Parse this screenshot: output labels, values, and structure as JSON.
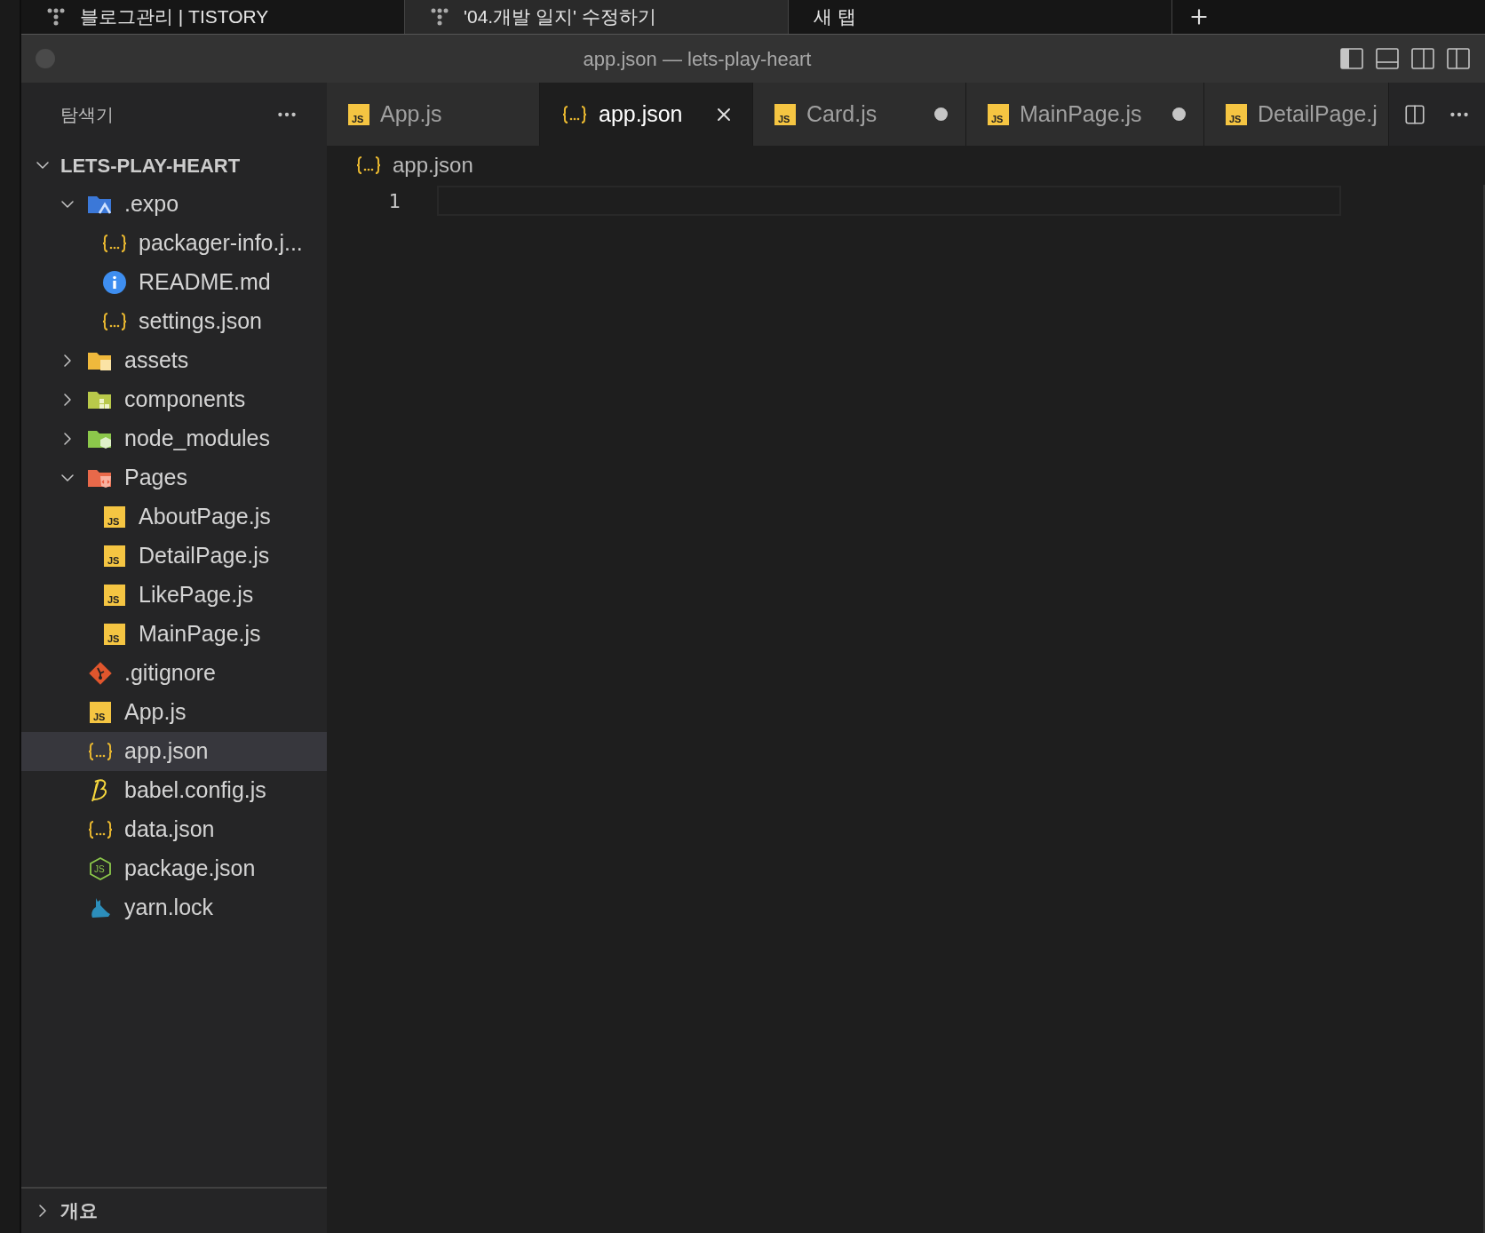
{
  "browser_tabs": [
    {
      "label": "블로그관리 | TISTORY",
      "selected": false
    },
    {
      "label": "'04.개발 일지' 수정하기",
      "selected": true
    },
    {
      "label": "새 탭",
      "selected": false
    }
  ],
  "window": {
    "title": "app.json — lets-play-heart"
  },
  "sidebar": {
    "title": "탐색기",
    "tree": {
      "label": "LETS-PLAY-HEART",
      "expanded": true,
      "children": [
        {
          "label": ".expo",
          "kind": "expo-folder",
          "expanded": true,
          "selected": false,
          "children": [
            {
              "label": "packager-info.j...",
              "kind": "json",
              "selected": false
            },
            {
              "label": "README.md",
              "kind": "info",
              "selected": false
            },
            {
              "label": "settings.json",
              "kind": "json",
              "selected": false
            }
          ]
        },
        {
          "label": "assets",
          "kind": "assets-folder",
          "expanded": false,
          "selected": false
        },
        {
          "label": "components",
          "kind": "components-folder",
          "expanded": false,
          "selected": false
        },
        {
          "label": "node_modules",
          "kind": "node-folder",
          "expanded": false,
          "selected": false
        },
        {
          "label": "Pages",
          "kind": "pages-folder",
          "expanded": true,
          "selected": false,
          "children": [
            {
              "label": "AboutPage.js",
              "kind": "js",
              "icon_text": "JS",
              "selected": false
            },
            {
              "label": "DetailPage.js",
              "kind": "js",
              "icon_text": "JS",
              "selected": false
            },
            {
              "label": "LikePage.js",
              "kind": "js",
              "icon_text": "JS",
              "selected": false
            },
            {
              "label": "MainPage.js",
              "kind": "js",
              "icon_text": "JS",
              "selected": false
            }
          ]
        },
        {
          "label": ".gitignore",
          "kind": "git",
          "selected": false
        },
        {
          "label": "App.js",
          "kind": "js",
          "icon_text": "JS",
          "selected": false
        },
        {
          "label": "app.json",
          "kind": "json",
          "selected": true
        },
        {
          "label": "babel.config.js",
          "kind": "babel",
          "selected": false
        },
        {
          "label": "data.json",
          "kind": "json",
          "selected": false
        },
        {
          "label": "package.json",
          "kind": "node",
          "icon_text": "JS",
          "selected": false
        },
        {
          "label": "yarn.lock",
          "kind": "yarn",
          "selected": false
        }
      ]
    },
    "outline": {
      "label": "개요",
      "expanded": false
    }
  },
  "editor_tabs": [
    {
      "label": "App.js",
      "kind": "js",
      "icon_text": "JS",
      "selected": false,
      "modified": false
    },
    {
      "label": "app.json",
      "kind": "json",
      "selected": true,
      "modified": false
    },
    {
      "label": "Card.js",
      "kind": "js",
      "icon_text": "JS",
      "selected": false,
      "modified": true
    },
    {
      "label": "MainPage.js",
      "kind": "js",
      "icon_text": "JS",
      "selected": false,
      "modified": true
    },
    {
      "label": "DetailPage.j",
      "kind": "js",
      "icon_text": "JS",
      "selected": false,
      "modified": false
    }
  ],
  "breadcrumb": {
    "label": "app.json",
    "kind": "json"
  },
  "editor": {
    "line_numbers": [
      "1"
    ]
  }
}
